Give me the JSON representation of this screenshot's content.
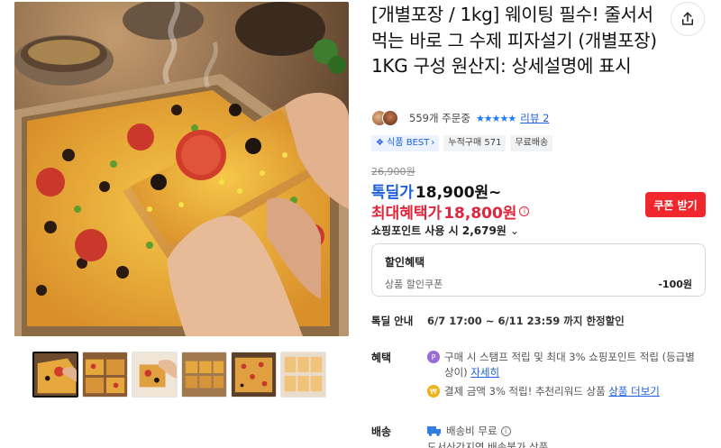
{
  "product": {
    "title": "[개별포장 / 1kg] 웨이팅 필수! 줄서서 먹는 바로 그 수제 피자설기 (개별포장) 1KG 구성 원산지: 상세설명에 표시",
    "orders": "559개 주문중",
    "stars": "★★★★★",
    "review_link": "리뷰 2"
  },
  "badges": {
    "best": "식품 BEST",
    "cumulative": "누적구매 571",
    "free_shipping": "무료배송"
  },
  "price": {
    "original": "26,900원",
    "deal_label": "톡딜가",
    "deal_price": "18,900원~",
    "max_label": "최대혜택가",
    "max_price": "18,800원",
    "info_icon": "i"
  },
  "coupon_button": "쿠폰 받기",
  "points": "쇼핑포인트 사용 시 2,679원",
  "discount": {
    "title": "할인혜택",
    "row_label": "상품 할인쿠폰",
    "row_amount": "-100원"
  },
  "deal_notice": {
    "label": "톡딜 안내",
    "value": "6/7 17:00 ~ 6/11 23:59 까지 한정할인"
  },
  "benefits": {
    "label": "혜택",
    "item1_icon": "P",
    "item1_text": "구매 시 스탬프 적립 및 최대 3% 쇼핑포인트 적립 (등급별 상이)",
    "item1_link": "자세히",
    "item2_icon": "₩",
    "item2_text": "결제 금액 3% 적립! 추천리워드 상품",
    "item2_link": "상품 더보기"
  },
  "shipping": {
    "label": "배송",
    "line1": "배송비 무료",
    "line2": "도서산간지역 배송불가 상품"
  },
  "icons": {
    "share": "share-icon",
    "star": "star-icon",
    "truck": "truck-icon"
  },
  "colors": {
    "deal_blue": "#1e5fe0",
    "max_red": "#e0263c",
    "coupon_red": "#f0282d"
  }
}
